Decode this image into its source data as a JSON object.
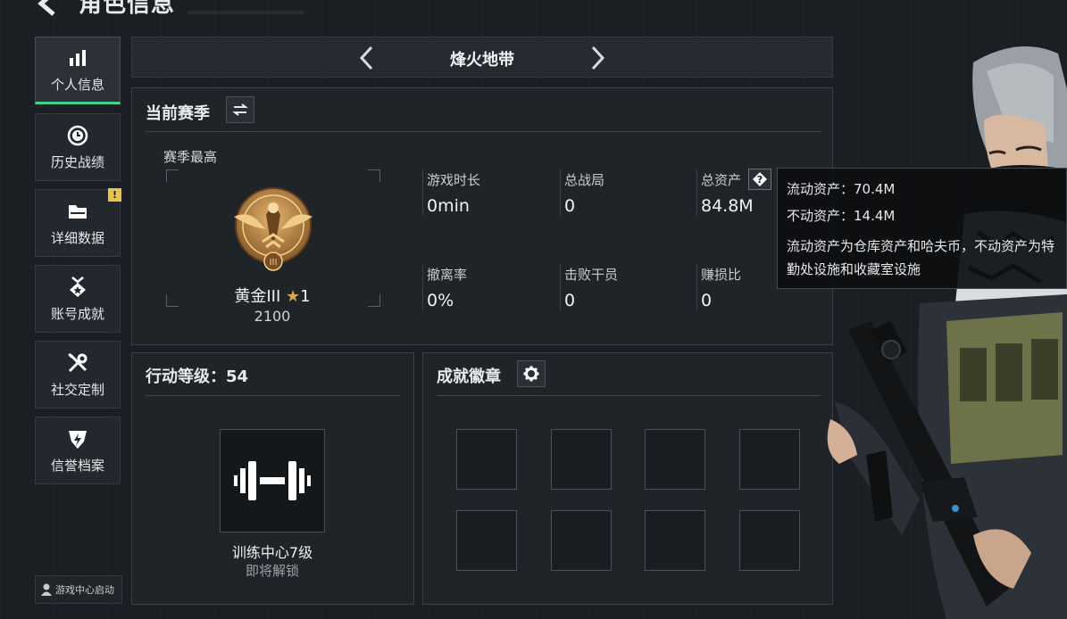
{
  "header": {
    "title": "角色信息"
  },
  "sidebar": {
    "items": [
      {
        "label": "个人信息",
        "icon": "bar-chart-icon"
      },
      {
        "label": "历史战绩",
        "icon": "clock-icon"
      },
      {
        "label": "详细数据",
        "icon": "folder-icon",
        "badge": "!"
      },
      {
        "label": "账号成就",
        "icon": "medal-icon"
      },
      {
        "label": "社交定制",
        "icon": "tools-icon"
      },
      {
        "label": "信誉档案",
        "icon": "shield-bolt-icon"
      }
    ],
    "launch": "游戏中心启动"
  },
  "mode": {
    "title": "烽火地带"
  },
  "season": {
    "title": "当前赛季",
    "best_label": "赛季最高",
    "rank_name": "黄金III",
    "rank_stars": "1",
    "rank_score": "2100",
    "stats": [
      {
        "label": "游戏时长",
        "value": "0min"
      },
      {
        "label": "总战局",
        "value": "0"
      },
      {
        "label": "总资产",
        "value": "84.8M"
      },
      {
        "label": "撤离率",
        "value": "0%"
      },
      {
        "label": "击败干员",
        "value": "0"
      },
      {
        "label": "赚损比",
        "value": "0"
      }
    ]
  },
  "tooltip": {
    "liquid": "流动资产：70.4M",
    "fixed": "不动资产：14.4M",
    "desc": "流动资产为仓库资产和哈夫币，不动资产为特勤处设施和收藏室设施"
  },
  "action_level": {
    "title": "行动等级：54"
  },
  "training": {
    "name": "训练中心7级",
    "status": "即将解锁"
  },
  "achievements": {
    "title": "成就徽章"
  },
  "colors": {
    "accent": "#3fd38b",
    "alert": "#e8c54a",
    "gold": "#c9964d"
  }
}
